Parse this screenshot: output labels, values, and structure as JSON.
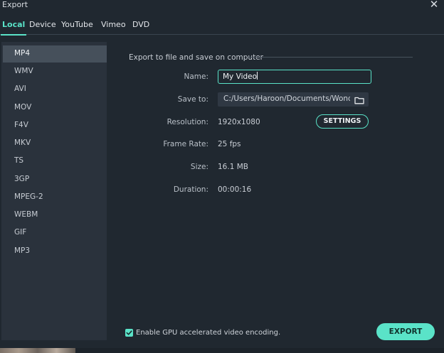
{
  "window": {
    "title": "Export"
  },
  "tabs": [
    {
      "label": "Local",
      "active": true
    },
    {
      "label": "Device",
      "active": false
    },
    {
      "label": "YouTube",
      "active": false
    },
    {
      "label": "Vimeo",
      "active": false
    },
    {
      "label": "DVD",
      "active": false
    }
  ],
  "formats": [
    "MP4",
    "WMV",
    "AVI",
    "MOV",
    "F4V",
    "MKV",
    "TS",
    "3GP",
    "MPEG-2",
    "WEBM",
    "GIF",
    "MP3"
  ],
  "selected_format": "MP4",
  "section": {
    "title": "Export to file and save on computer"
  },
  "fields": {
    "name_label": "Name:",
    "name_value": "My Video",
    "save_label": "Save to:",
    "save_value": "C:/Users/Haroon/Documents/Wondersha",
    "resolution_label": "Resolution:",
    "resolution_value": "1920x1080",
    "framerate_label": "Frame Rate:",
    "framerate_value": "25 fps",
    "size_label": "Size:",
    "size_value": "16.1 MB",
    "duration_label": "Duration:",
    "duration_value": "00:00:16"
  },
  "buttons": {
    "settings": "SETTINGS",
    "export": "EXPORT"
  },
  "gpu": {
    "label": "Enable GPU accelerated video encoding.",
    "checked": true
  },
  "colors": {
    "accent": "#5ae3c8",
    "background": "#202830",
    "sidebar": "#2a323c",
    "selected": "#46505b"
  },
  "icons": {
    "close": "close-icon",
    "folder": "folder-icon",
    "check": "checkmark-icon"
  }
}
